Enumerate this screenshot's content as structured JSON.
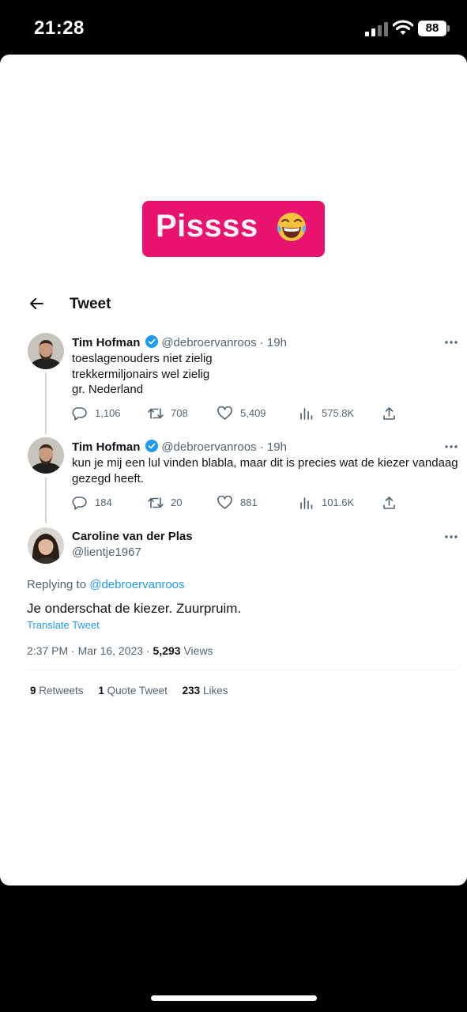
{
  "status_bar": {
    "time": "21:28",
    "battery": "88"
  },
  "sticker": {
    "text": "Pissss",
    "emoji": "face-with-tears-of-joy"
  },
  "header": {
    "title": "Tweet"
  },
  "tweets": [
    {
      "name": "Tim Hofman",
      "handle": "@debroervanroos · 19h",
      "lines": [
        "toeslagenouders niet zielig",
        "trekkermiljonairs wel zielig",
        "gr. Nederland"
      ],
      "replies": "1,106",
      "retweets": "708",
      "likes": "5,409",
      "views": "575.8K"
    },
    {
      "name": "Tim Hofman",
      "handle": "@debroervanroos · 19h",
      "lines": [
        "kun je mij een lul vinden blabla, maar dit is precies wat de kiezer vandaag",
        "gezegd heeft."
      ],
      "replies": "184",
      "retweets": "20",
      "likes": "881",
      "views": "101.6K"
    }
  ],
  "main_tweet": {
    "name": "Caroline van der Plas",
    "handle": "@lientje1967",
    "replying_prefix": "Replying to ",
    "replying_handle": "@debroervanroos",
    "text": "Je onderschat de kiezer. Zuurpruim.",
    "translate": "Translate Tweet",
    "timestamp": "2:37 PM · Mar 16, 2023 · ",
    "views_count": "5,293",
    "views_label": " Views",
    "stats": {
      "retweets_count": "9",
      "retweets_label": " Retweets",
      "quotes_count": "1",
      "quotes_label": " Quote Tweet",
      "likes_count": "233",
      "likes_label": " Likes"
    }
  },
  "colors": {
    "accent": "#1d9bf0",
    "sticker": "#e8136e",
    "secondary_text": "#536471"
  }
}
